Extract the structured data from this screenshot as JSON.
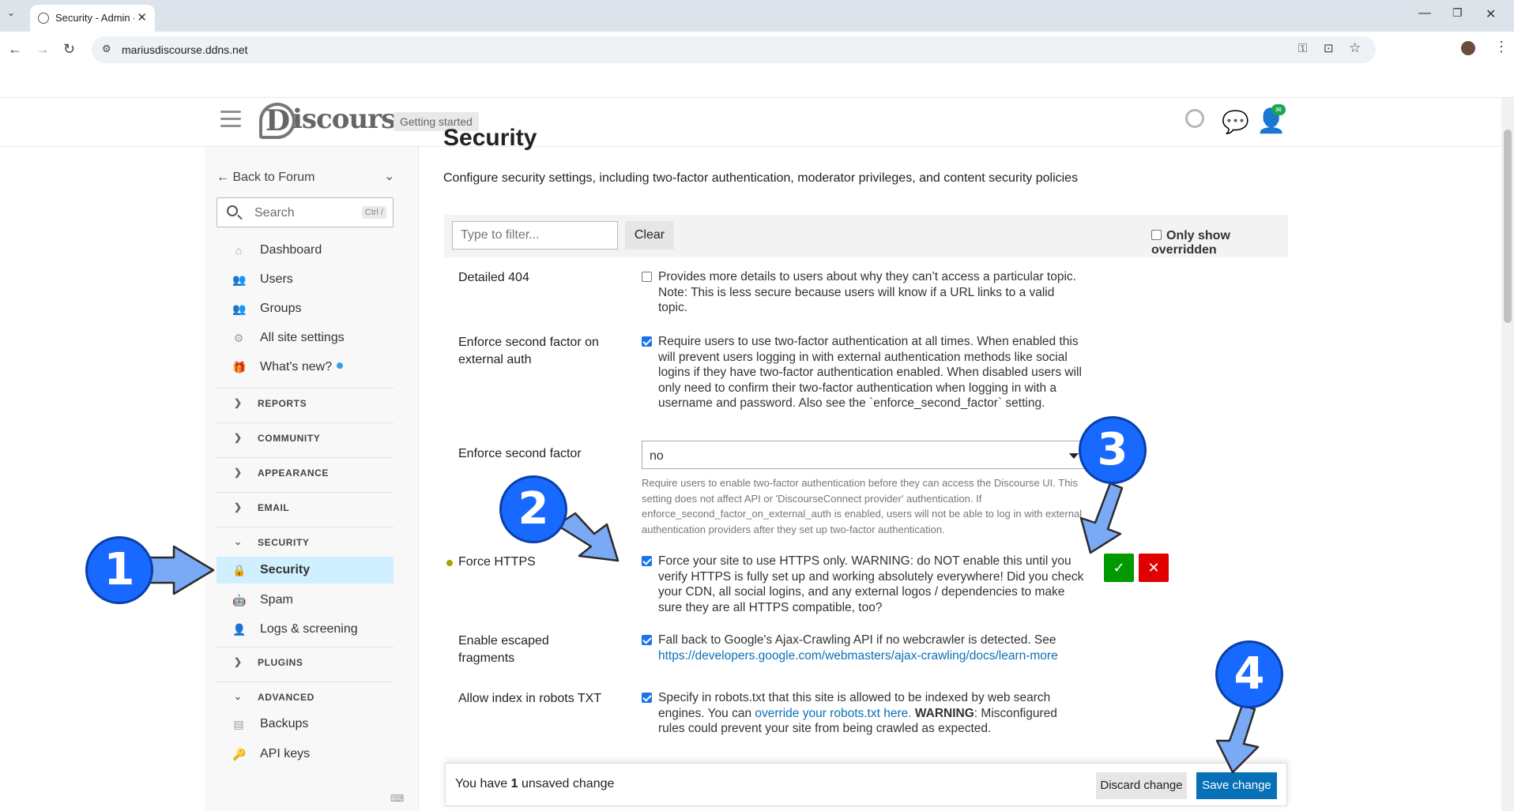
{
  "browser": {
    "tab_title": "Security - Admin - ",
    "url": "mariusdiscourse.ddns.net"
  },
  "header": {
    "logo_text": "iscourse",
    "getting_started": "Getting started"
  },
  "sidebar": {
    "back": "Back to Forum",
    "search_placeholder": "Search",
    "search_shortcut": "Ctrl /",
    "links": [
      {
        "label": "Dashboard",
        "icon": "home-icon"
      },
      {
        "label": "Users",
        "icon": "users-icon"
      },
      {
        "label": "Groups",
        "icon": "groups-icon"
      },
      {
        "label": "All site settings",
        "icon": "gear-icon"
      },
      {
        "label": "What's new?",
        "icon": "gift-icon"
      }
    ],
    "sections": {
      "reports": "REPORTS",
      "community": "COMMUNITY",
      "appearance": "APPEARANCE",
      "email": "EMAIL",
      "security": "SECURITY",
      "plugins": "PLUGINS",
      "advanced": "ADVANCED"
    },
    "security_links": [
      {
        "label": "Security",
        "icon": "lock-icon"
      },
      {
        "label": "Spam",
        "icon": "robot-icon"
      },
      {
        "label": "Logs & screening",
        "icon": "user-shield-icon"
      }
    ],
    "advanced_links": [
      {
        "label": "Backups",
        "icon": "archive-icon"
      },
      {
        "label": "API keys",
        "icon": "key-icon"
      }
    ]
  },
  "main": {
    "heading": "Security",
    "description": "Configure security settings, including two-factor authentication, moderator privileges, and content security policies",
    "filter_placeholder": "Type to filter...",
    "clear": "Clear",
    "only_overridden": "Only show overridden",
    "settings": [
      {
        "name": "Detailed 404",
        "checked": false,
        "desc": "Provides more details to users about why they can’t access a particular topic. Note: This is less secure because users will know if a URL links to a valid topic."
      },
      {
        "name": "Enforce second factor on external auth",
        "checked": true,
        "desc": "Require users to use two-factor authentication at all times. When enabled this will prevent users logging in with external authentication methods like social logins if they have two-factor authentication enabled. When disabled users will only need to confirm their two-factor authentication when logging in with a username and password. Also see the `enforce_second_factor` setting."
      },
      {
        "name": "Enforce second factor",
        "value": "no",
        "desc": "Require users to enable two-factor authentication before they can access the Discourse UI. This setting does not affect API or 'DiscourseConnect provider' authentication. If enforce_second_factor_on_external_auth is enabled, users will not be able to log in with external authentication providers after they set up two-factor authentication."
      },
      {
        "name": "Force HTTPS",
        "checked": true,
        "desc": "Force your site to use HTTPS only. WARNING: do NOT enable this until you verify HTTPS is fully set up and working absolutely everywhere! Did you check your CDN, all social logins, and any external logos / dependencies to make sure they are all HTTPS compatible, too?"
      },
      {
        "name": "Enable escaped fragments",
        "checked": true,
        "desc": "Fall back to Google's Ajax-Crawling API if no webcrawler is detected. See",
        "link": "https://developers.google.com/webmasters/ajax-crawling/docs/learn-more"
      },
      {
        "name": "Allow index in robots TXT",
        "checked": true,
        "desc_before": "Specify in robots.txt that this site is allowed to be indexed by web search engines. You can",
        "link": "override your robots.txt here.",
        "warning": "WARNING",
        "desc_after": ": Misconfigured rules could prevent your site from being crawled as expected."
      }
    ]
  },
  "savebar": {
    "msg_before": "You have",
    "count": "1",
    "msg_after": "unsaved change",
    "discard": "Discard change",
    "save": "Save change"
  },
  "annotations": [
    "1",
    "2",
    "3",
    "4"
  ],
  "colors": {
    "accent": "#0870b7",
    "active_bg": "#d1f0ff",
    "ok": "#009900",
    "cancel": "#e00000",
    "badge": "#1769ff",
    "arrow": "#7aa9f5"
  }
}
